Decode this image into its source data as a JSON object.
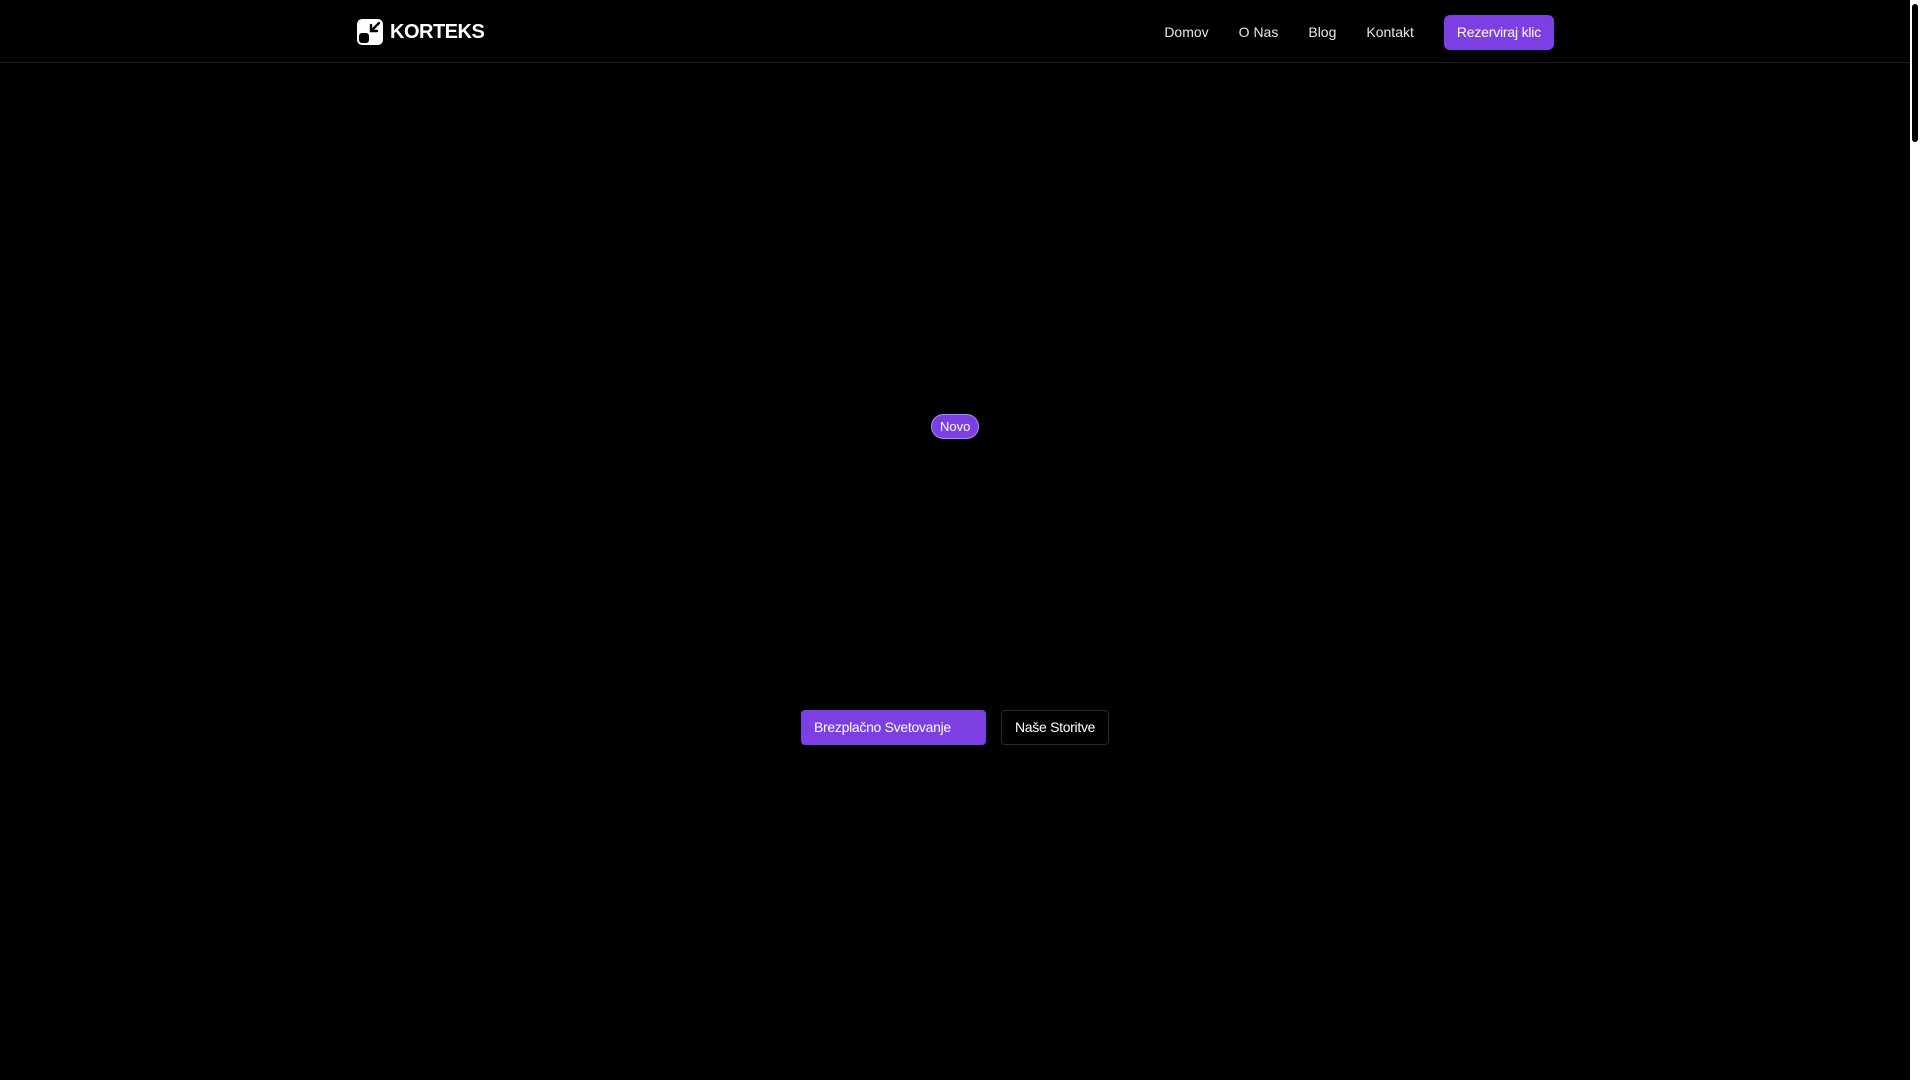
{
  "header": {
    "brand": "KORTEKS",
    "logo_icon": "korteks-logo-icon",
    "nav": [
      {
        "label": "Domov"
      },
      {
        "label": "O Nas"
      },
      {
        "label": "Blog"
      },
      {
        "label": "Kontakt"
      }
    ],
    "cta_label": "Rezerviraj klic"
  },
  "hero": {
    "badge": "Novo",
    "primary_button": "Brezplačno Svetovanje",
    "secondary_button": "Naše Storitve"
  },
  "colors": {
    "background": "#000000",
    "accent": "#7b3fe4",
    "text": "#ffffff"
  }
}
